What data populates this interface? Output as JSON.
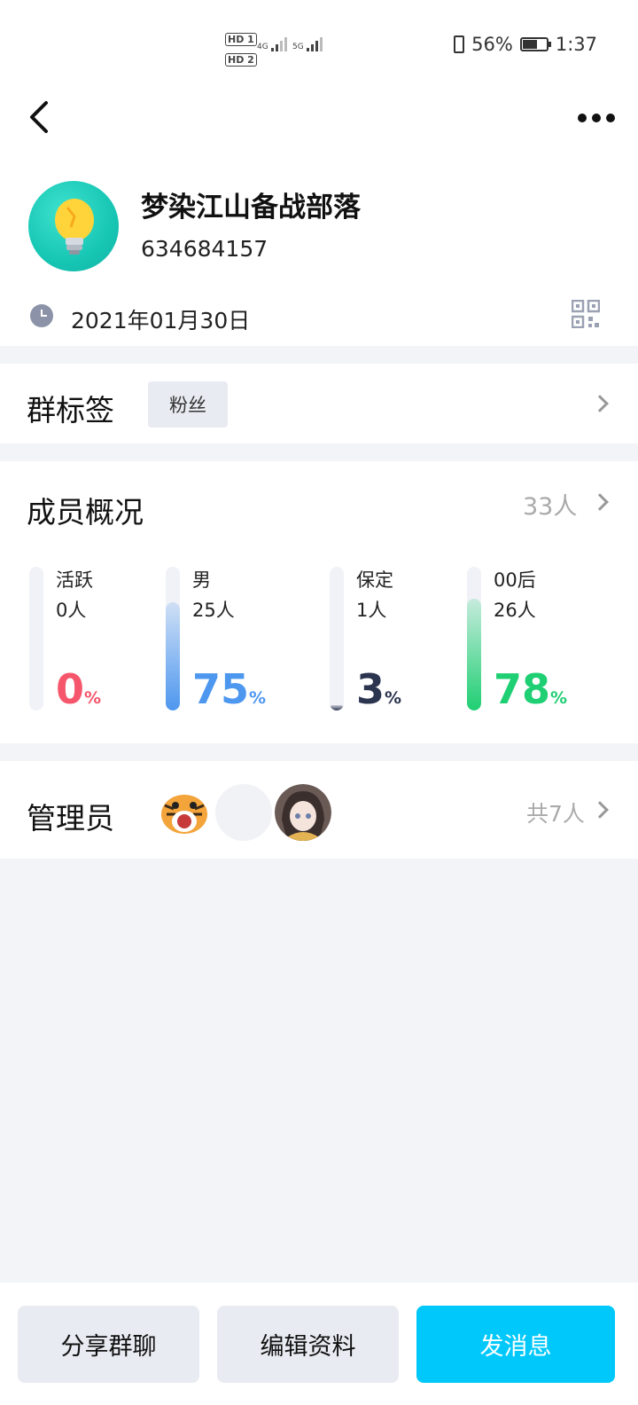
{
  "status_bar": {
    "hd1": "HD 1",
    "hd2": "HD 2",
    "net1": "4G",
    "net2": "5G",
    "battery": "56%",
    "time": "1:37"
  },
  "group": {
    "name": "梦染江山备战部落",
    "id": "634684157",
    "created": "2021年01月30日",
    "avatar_icon": "lightbulb-icon"
  },
  "tags": {
    "title": "群标签",
    "items": [
      "粉丝"
    ]
  },
  "members": {
    "title": "成员概况",
    "count": "33人",
    "stats": [
      {
        "label": "活跃",
        "count": "0人",
        "pct": "0",
        "fraction": 0.0,
        "color": "#f5566b",
        "bar": "#f5566b"
      },
      {
        "label": "男",
        "count": "25人",
        "pct": "75",
        "fraction": 0.75,
        "color": "#4e97ef",
        "bar": "#4e97ef"
      },
      {
        "label": "保定",
        "count": "1人",
        "pct": "3",
        "fraction": 0.03,
        "color": "#2c3550",
        "bar": "#2c3550"
      },
      {
        "label": "00后",
        "count": "26人",
        "pct": "78",
        "fraction": 0.78,
        "color": "#1fcf73",
        "bar": "#1fcf73"
      }
    ],
    "pct_unit": "%"
  },
  "admins": {
    "title": "管理员",
    "total": "共7人"
  },
  "actions": {
    "share": "分享群聊",
    "edit": "编辑资料",
    "send": "发消息"
  }
}
